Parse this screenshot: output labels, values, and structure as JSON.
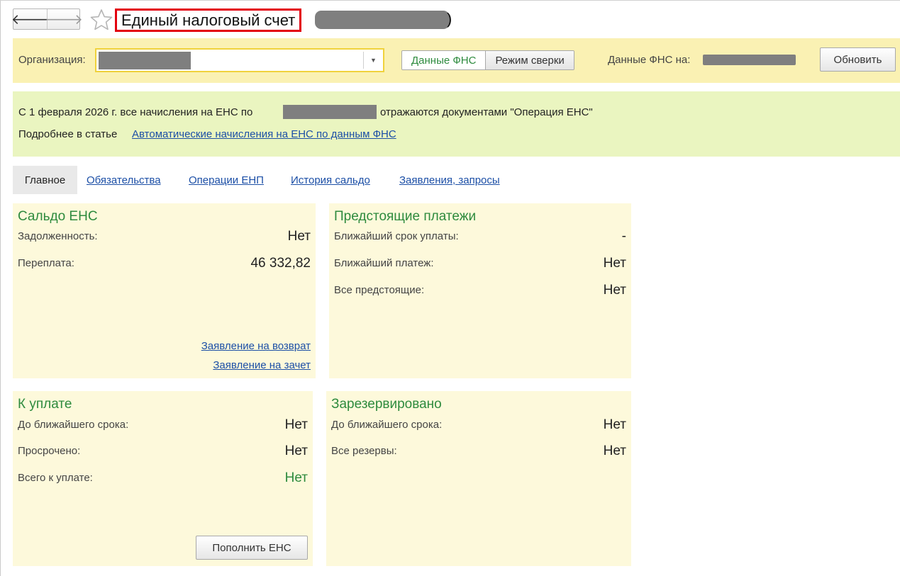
{
  "title": {
    "text": "Единый налоговый счет",
    "paren": ")"
  },
  "icons": {
    "back": "arrow-left-icon",
    "forward": "arrow-right-icon",
    "favorite": "star-icon",
    "dropdown": "chevron-down-icon"
  },
  "nav": {
    "back_glyph": "🡐",
    "forward_glyph": "🡒"
  },
  "org_bar": {
    "label": "Организация:",
    "dropdown_glyph": "▼",
    "mode_buttons": [
      "Данные ФНС",
      "Режим сверки"
    ],
    "active_mode": "Данные ФНС",
    "fns_date_label": "Данные ФНС на:",
    "refresh_label": "Обновить"
  },
  "info": {
    "line1_prefix": "С 1 февраля 2026 г. все начисления на ЕНС по",
    "line1_suffix": "отражаются документами \"Операция ЕНС\"",
    "line2_prefix": "Подробнее в статье",
    "line2_link": "Автоматические начисления на ЕНС по данным ФНС"
  },
  "tabs": [
    "Главное",
    "Обязательства",
    "Операции ЕНП",
    "История сальдо",
    "Заявления, запросы"
  ],
  "cards": {
    "saldo": {
      "title": "Сальдо ЕНС",
      "rows": [
        {
          "label": "Задолженность:",
          "value": "Нет"
        },
        {
          "label": "Переплата:",
          "value": "46 332,82"
        }
      ],
      "links": [
        "Заявление на возврат",
        "Заявление на зачет"
      ]
    },
    "upcoming": {
      "title": "Предстоящие платежи",
      "rows": [
        {
          "label": "Ближайший срок уплаты:",
          "value": "-"
        },
        {
          "label": "Ближайший платеж:",
          "value": "Нет"
        },
        {
          "label": "Все предстоящие:",
          "value": "Нет"
        }
      ]
    },
    "to_pay": {
      "title": "К уплате",
      "rows": [
        {
          "label": "До ближайшего срока:",
          "value": "Нет"
        },
        {
          "label": "Просрочено:",
          "value": "Нет"
        },
        {
          "label": "Всего к уплате:",
          "value": "Нет"
        }
      ],
      "button": "Пополнить ЕНС"
    },
    "reserved": {
      "title": "Зарезервировано",
      "rows": [
        {
          "label": "До ближайшего срока:",
          "value": "Нет"
        },
        {
          "label": "Все резервы:",
          "value": "Нет"
        }
      ]
    }
  },
  "colors": {
    "accent_green": "#2e8b3e",
    "link_blue": "#1c4fa6",
    "title_highlight": "#e3000f",
    "org_bar_bg": "#faf1b3",
    "info_bg": "#eaf5c0",
    "card_bg": "#fdf9db"
  }
}
